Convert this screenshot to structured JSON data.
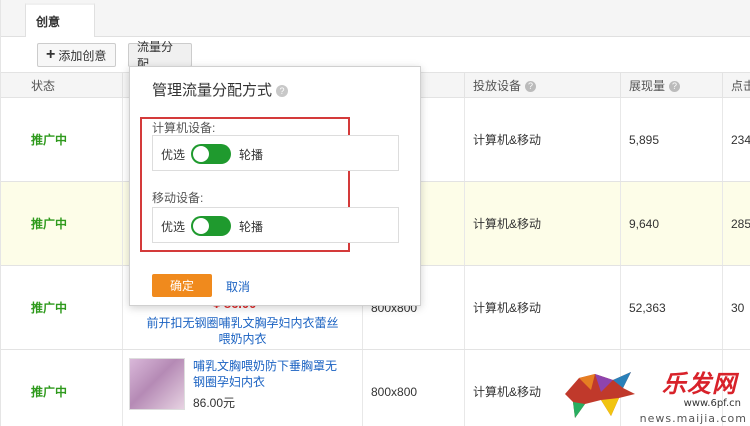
{
  "tabs": [
    {
      "label": "创意"
    }
  ],
  "toolbar": {
    "add_label": "添加创意",
    "flow_label": "流量分配"
  },
  "table": {
    "headers": {
      "status": "状态",
      "device": "投放设备",
      "impressions": "展现量",
      "clicks": "点击"
    },
    "rows": [
      {
        "status": "推广中",
        "device": "计算机&移动",
        "impressions": "5,895",
        "clicks": "234"
      },
      {
        "status": "推广中",
        "device": "计算机&移动",
        "impressions": "9,640",
        "clicks": "285"
      },
      {
        "status": "推广中",
        "price": "¥ 86.00",
        "title": "前开扣无钢圈哺乳文胸孕妇内衣蕾丝喂奶内衣",
        "size": "800x800",
        "device": "计算机&移动",
        "impressions": "52,363",
        "clicks": "30"
      },
      {
        "status": "推广中",
        "title": "哺乳文胸喂奶防下垂胸罩无钢圈孕妇内衣",
        "price": "86.00元",
        "size": "800x800",
        "device": "计算机&移动",
        "impressions": "",
        "clicks": ""
      }
    ]
  },
  "popup": {
    "title": "管理流量分配方式",
    "pc_label": "计算机设备:",
    "mobile_label": "移动设备:",
    "option_left": "优选",
    "option_right": "轮播",
    "confirm_label": "确定",
    "cancel_label": "取消"
  },
  "watermark": {
    "brand": "乐发网",
    "url1": "www.6pf.cn",
    "url2": "news.maijia.com"
  },
  "colors": {
    "status_green": "#2f9a1d",
    "toggle_green": "#1f9a2e",
    "confirm_orange": "#f08a1d",
    "link_blue": "#1a62c2",
    "highlight_red": "#d43a3a"
  }
}
